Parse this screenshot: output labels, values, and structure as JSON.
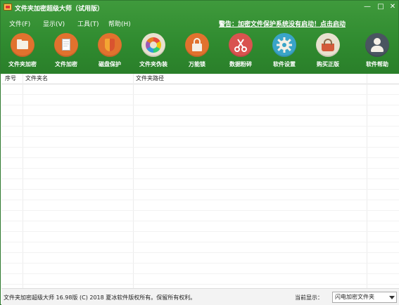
{
  "window": {
    "title": "文件夹加密超级大师（试用版）",
    "controls": {
      "minimize": "—",
      "maximize": "□",
      "close": "✕"
    }
  },
  "menu": [
    {
      "label": "文件(F)"
    },
    {
      "label": "显示(V)"
    },
    {
      "label": "工具(T)"
    },
    {
      "label": "帮助(H)"
    }
  ],
  "warning": "警告：加密文件保护系统没有启动！点击启动",
  "toolbar": [
    {
      "label": "文件夹加密",
      "icon": "folder-icon",
      "color": "#e1722e"
    },
    {
      "label": "文件加密",
      "icon": "document-icon",
      "color": "#e1722e"
    },
    {
      "label": "磁盘保护",
      "icon": "shield-icon",
      "color": "#e1722e"
    },
    {
      "label": "文件夹伪装",
      "icon": "color-wheel-icon",
      "color": "#e8e1cf"
    },
    {
      "label": "万能锁",
      "icon": "lock-icon",
      "color": "#e1722e"
    },
    {
      "label": "数据粉碎",
      "icon": "scissors-icon",
      "color": "#d9534f"
    },
    {
      "label": "软件设置",
      "icon": "gear-icon",
      "color": "#3aa4c8"
    },
    {
      "label": "购买正版",
      "icon": "basket-icon",
      "color": "#e8e1cf"
    },
    {
      "label": "软件帮助",
      "icon": "user-icon",
      "color": "#4a5560"
    }
  ],
  "table": {
    "columns": [
      "序号",
      "文件夹名",
      "文件夹路径"
    ],
    "rows": []
  },
  "status": {
    "text": "文件夹加密超级大师 16.98版 (C) 2018  夏冰软件版权所有。保留所有权利。",
    "current_label": "当前显示：",
    "current_value": "闪电加密文件夹"
  }
}
